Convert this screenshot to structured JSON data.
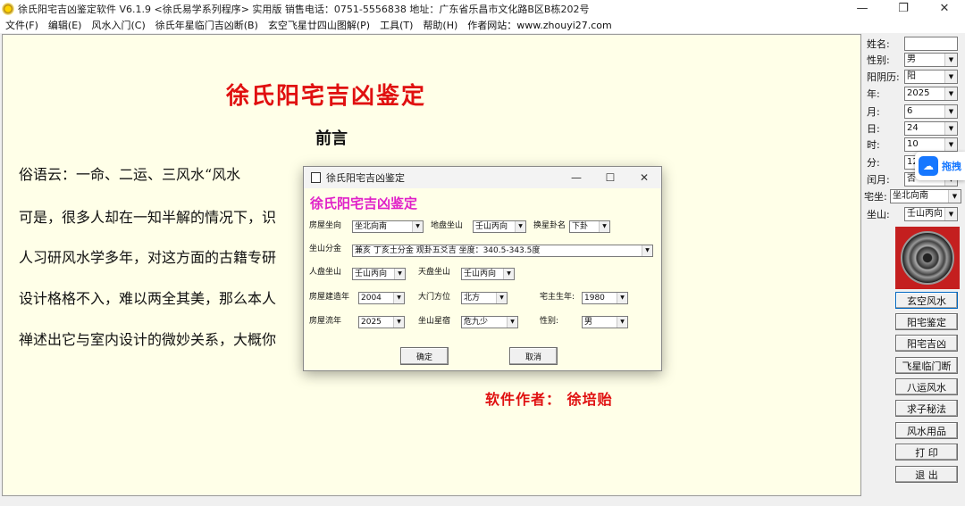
{
  "window": {
    "title": "徐氏阳宅吉凶鉴定软件 V6.1.9  <徐氏易学系列程序> 实用版   销售电话：0751-5556838   地址：广东省乐昌市文化路B区B栋202号",
    "minimize": "—",
    "maximize": "❐",
    "close": "✕"
  },
  "menu": [
    "文件(F)",
    "编辑(E)",
    "风水入门(C)",
    "徐氏年星临门吉凶断(B)",
    "玄空飞星廿四山图解(P)",
    "工具(T)",
    "帮助(H)",
    "作者网站：www.zhouyi27.com"
  ],
  "document": {
    "title": "徐氏阳宅吉凶鉴定",
    "subtitle": "前言",
    "lines": [
      "    俗语云：一命、二运、三风水“风水",
      "可是，很多人却在一知半解的情况下，识",
      "人习研风水学多年，对这方面的古籍专研",
      "设计格格不入，难以两全其美，那么本人",
      "禅述出它与室内设计的微妙关系，大概你"
    ],
    "author": "软件作者：  徐培贻"
  },
  "panel": {
    "name_label": "姓名:",
    "name_value": "",
    "gender_label": "性别:",
    "gender_value": "男",
    "calendar_label": "阳阴历:",
    "calendar_value": "阳",
    "year_label": "年:",
    "year_value": "2025",
    "month_label": "月:",
    "month_value": "6",
    "day_label": "日:",
    "day_value": "24",
    "hour_label": "时:",
    "hour_value": "10",
    "minute_label": "分:",
    "minute_value": "12",
    "leap_label": "闰月:",
    "leap_value": "否",
    "house_sit_label": "宅坐:",
    "house_sit_value": "坐北向南",
    "mountain_label": "坐山:",
    "mountain_value": "壬山丙向",
    "buttons": [
      "玄空风水",
      "阳宅鉴定",
      "阳宅吉凶",
      "飞星临门断",
      "八运风水",
      "求子秘法",
      "风水用品",
      "打  印",
      "退  出"
    ]
  },
  "float_tab": {
    "label": "拖拽"
  },
  "dialog": {
    "title": "徐氏阳宅吉凶鉴定",
    "heading": "徐氏阳宅吉凶鉴定",
    "house_facing_label": "房屋坐向",
    "house_facing_value": "坐北向南",
    "earth_mountain_label": "地盘坐山",
    "earth_mountain_value": "壬山丙向",
    "replace_gua_label": "换星卦名",
    "replace_gua_value": "下卦",
    "sit_division_label": "坐山分金",
    "sit_division_value": "兼亥  丁亥土分金  观卦五爻吉  坐度：340.5-343.5度",
    "human_mountain_label": "人盘坐山",
    "human_mountain_value": "壬山丙向",
    "heaven_mountain_label": "天盘坐山",
    "heaven_mountain_value": "壬山丙向",
    "build_year_label": "房屋建造年",
    "build_year_value": "2004",
    "door_dir_label": "大门方位",
    "door_dir_value": "北方",
    "owner_year_label": "宅主生年:",
    "owner_year_value": "1980",
    "flow_year_label": "房屋流年",
    "flow_year_value": "2025",
    "star_label": "坐山星宿",
    "star_value": "危九少",
    "gender_label": "性别:",
    "gender_value": "男",
    "ok": "确定",
    "cancel": "取消",
    "minimize": "—",
    "maximize": "☐",
    "close": "✕"
  },
  "colors": {
    "doc_bg": "#ffffe8",
    "title_red": "#e01010",
    "dialog_heading": "#e020c8",
    "compass_red": "#c41f1f"
  }
}
